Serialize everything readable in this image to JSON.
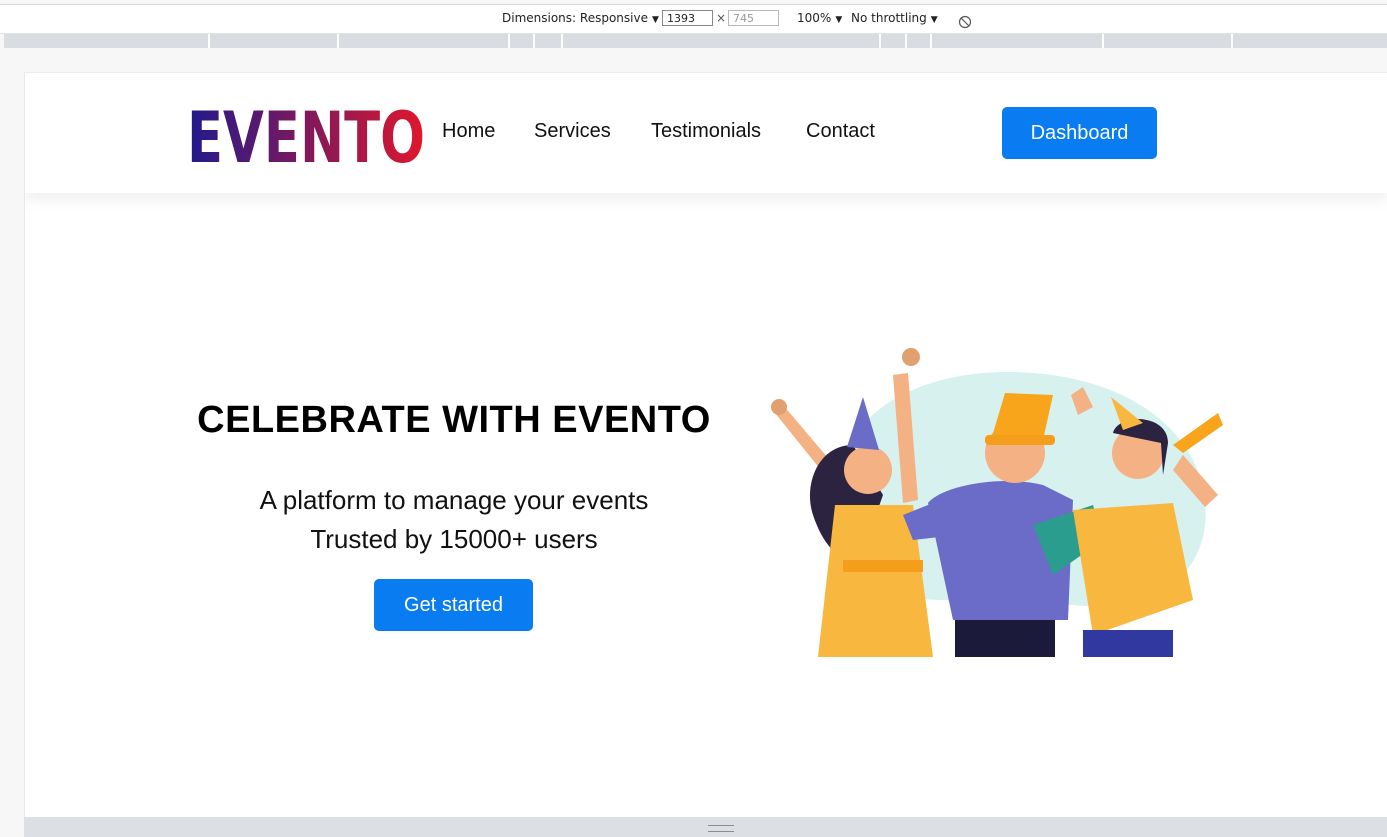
{
  "devtools": {
    "dimensions_label": "Dimensions: Responsive",
    "width_value": "1393",
    "height_value": "745",
    "times": "×",
    "zoom_label": "100%",
    "throttling_label": "No throttling",
    "arrow": "▼"
  },
  "brand": {
    "logo_text": "EVENTO",
    "gradient_start": "#1f1a8c",
    "gradient_end": "#e0172c"
  },
  "nav": {
    "links": [
      "Home",
      "Services",
      "Testimonials",
      "Contact"
    ],
    "dashboard_label": "Dashboard"
  },
  "hero": {
    "title": "CELEBRATE WITH EVENTO",
    "subtitle_line1": "A platform to manage your events",
    "subtitle_line2": "Trusted by 15000+ users",
    "cta_label": "Get started"
  },
  "colors": {
    "primary": "#0a7cf1",
    "blob": "#d7f1ef"
  }
}
